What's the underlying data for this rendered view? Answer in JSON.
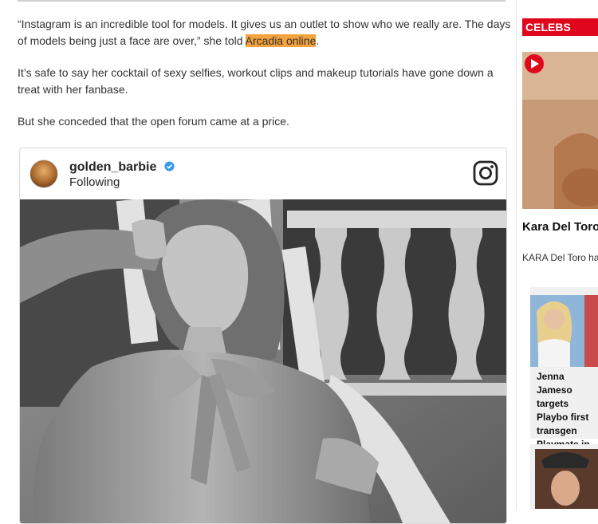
{
  "article": {
    "para1_before": "“Instagram is an incredible tool for models. It gives us an outlet to show who we really are. The days of models being just a face are over,” she told ",
    "para1_link": "Arcadia online",
    "para1_after": ".",
    "para2": "It’s safe to say her cocktail of sexy selfies, workout clips and makeup tutorials have gone down a treat with her fanbase.",
    "para3": "But she conceded that the open forum came at a price."
  },
  "instagram_embed": {
    "username": "golden_barbie",
    "follow_status": "Following",
    "icons": [
      "verified-badge-icon",
      "instagram-logo-icon"
    ],
    "colors": {
      "verified": "#3897f0"
    }
  },
  "sidebar": {
    "section_label": "CELEBS",
    "section_color": "#e0061c",
    "hero_title": "Kara Del Toro minuscule tw",
    "hero_summary": "KARA Del Toro ha thanks to her tanta",
    "card_title": "Jenna Jameso targets Playbo first transgen Playmate in ..."
  },
  "highlight_color": "#f3a23d"
}
